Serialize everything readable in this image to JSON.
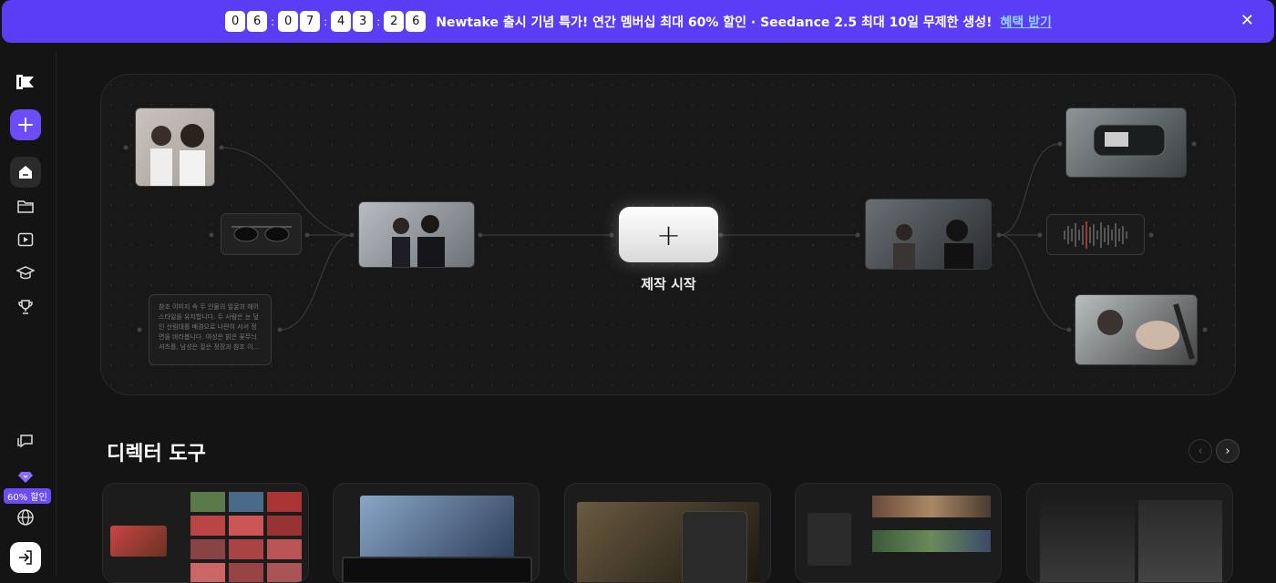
{
  "banner": {
    "timer_digits": [
      "0",
      "6",
      "0",
      "7",
      "4",
      "3",
      "2",
      "6"
    ],
    "timer_separator": ":",
    "text": "Newtake 출시 기념 특가! 연간 멤버십 최대 60% 할인 · Seedance 2.5 최대 10일 무제한 생성!",
    "link": "혜택 받기",
    "close": "✕"
  },
  "sidebar": {
    "discount_badge": "60% 할인"
  },
  "hero": {
    "text_node": "참조 이미지 속 두 인물의 얼굴과 헤어스타일을 유지합니다. 두 사람은 눈 덮인 산림대를 배경으로 나란히 서서 정면을 바라봅니다. 여성은 밝은 꽃무늬 셔츠를, 남성은 짙은 정장과 참조 이...",
    "start_label": "제작 시작",
    "start_icon": "+"
  },
  "director_tools": {
    "title": "디렉터 도구",
    "prev": "‹",
    "next": "›"
  },
  "colors": {
    "accent": "#6b4cf6",
    "banner": "#5b3df5",
    "link": "#8fd4ff"
  }
}
